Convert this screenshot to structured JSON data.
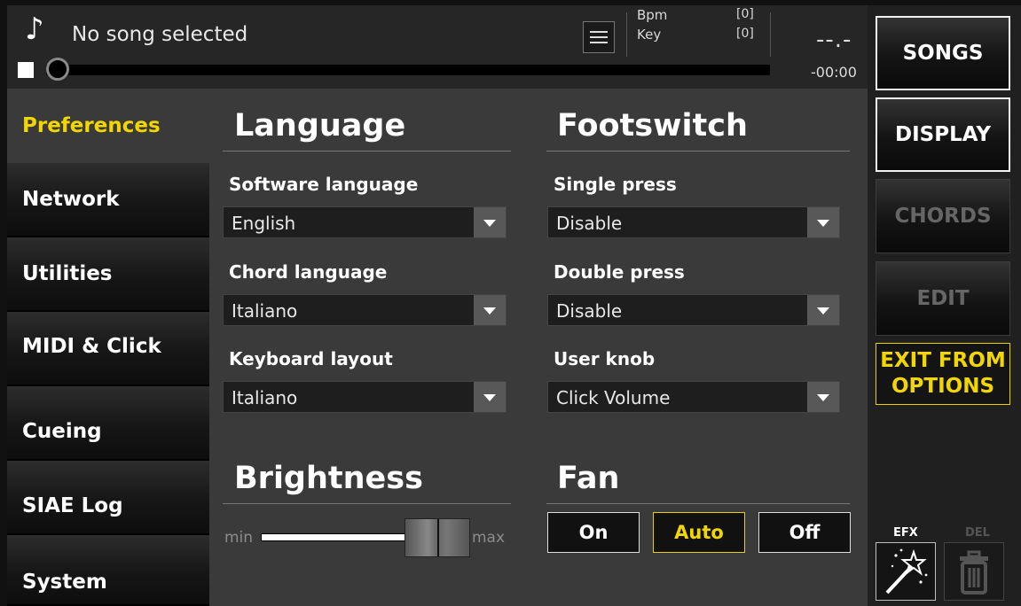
{
  "topbar": {
    "song_title": "No song selected",
    "bpm_label": "Bpm",
    "bpm_value": "[0]",
    "key_label": "Key",
    "key_value": "[0]",
    "time_display": "--.-",
    "time_remaining": "-00:00",
    "progress_fraction": 0
  },
  "nav": {
    "items": [
      {
        "label": "Preferences",
        "active": true
      },
      {
        "label": "Network"
      },
      {
        "label": "Utilities"
      },
      {
        "label": "MIDI & Click"
      },
      {
        "label": "Cueing"
      },
      {
        "label": "SIAE Log"
      },
      {
        "label": "System"
      }
    ]
  },
  "language": {
    "title": "Language",
    "software_label": "Software language",
    "software_value": "English",
    "chord_label": "Chord language",
    "chord_value": "Italiano",
    "keyboard_label": "Keyboard layout",
    "keyboard_value": "Italiano"
  },
  "footswitch": {
    "title": "Footswitch",
    "single_label": "Single press",
    "single_value": "Disable",
    "double_label": "Double press",
    "double_value": "Disable",
    "knob_label": "User knob",
    "knob_value": "Click Volume"
  },
  "brightness": {
    "title": "Brightness",
    "min_label": "min",
    "max_label": "max",
    "level_fraction": 0.8
  },
  "fan": {
    "title": "Fan",
    "options": [
      "On",
      "Auto",
      "Off"
    ],
    "selected": "Auto"
  },
  "right_panel": {
    "songs": "SONGS",
    "display": "DISPLAY",
    "chords": "CHORDS",
    "edit": "EDIT",
    "exit_line1": "EXIT FROM",
    "exit_line2": "OPTIONS",
    "efx_label": "EFX",
    "del_label": "DEL"
  },
  "colors": {
    "accent": "#f2d600",
    "panel": "#3a3a3a",
    "disabled_text": "#666666"
  }
}
